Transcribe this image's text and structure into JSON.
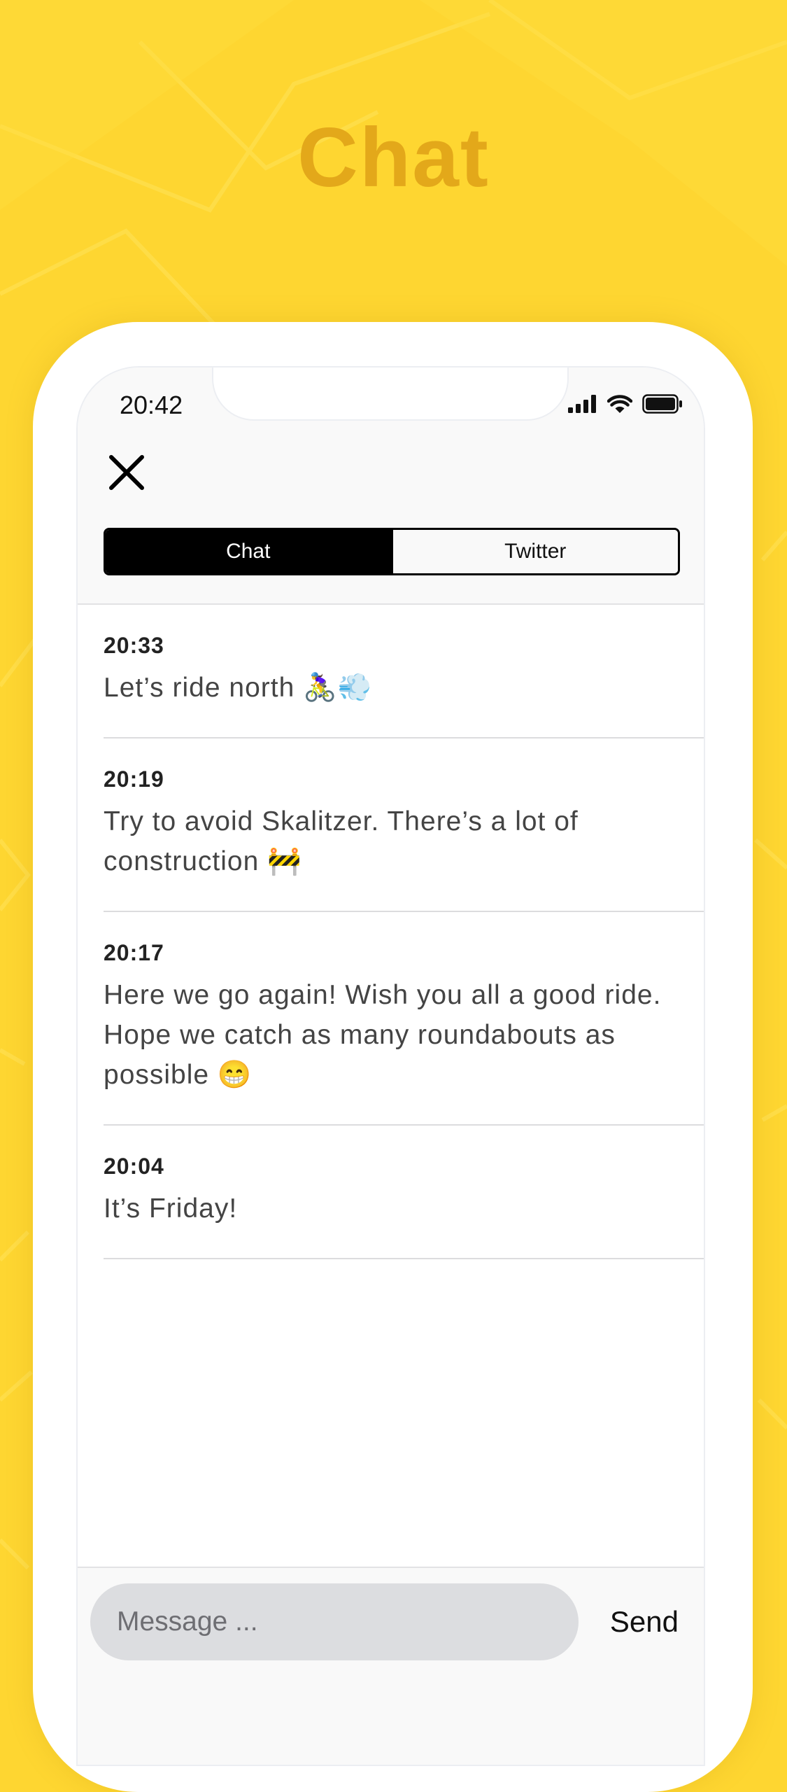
{
  "hero": {
    "title": "Chat"
  },
  "status_bar": {
    "time": "20:42",
    "icons": [
      "signal-bars-icon",
      "wifi-icon",
      "battery-icon"
    ]
  },
  "header": {
    "close_icon": "close-icon",
    "tabs": [
      {
        "label": "Chat",
        "selected": true
      },
      {
        "label": "Twitter",
        "selected": false
      }
    ]
  },
  "messages": [
    {
      "time": "20:33",
      "text": "Let’s ride north 🚴‍♀️💨"
    },
    {
      "time": "20:19",
      "text": "Try to avoid Skalitzer. There’s a lot of construction 🚧"
    },
    {
      "time": "20:17",
      "text": "Here we go again! Wish you all a good ride. Hope we catch as many roundabouts as possible 😁"
    },
    {
      "time": "20:04",
      "text": "It’s Friday!"
    }
  ],
  "composer": {
    "placeholder": "Message ...",
    "value": "",
    "send_label": "Send"
  },
  "colors": {
    "background": "#fed631",
    "title": "#e3a81a",
    "segment_active": "#000000",
    "input_bg": "#dcdde0"
  }
}
